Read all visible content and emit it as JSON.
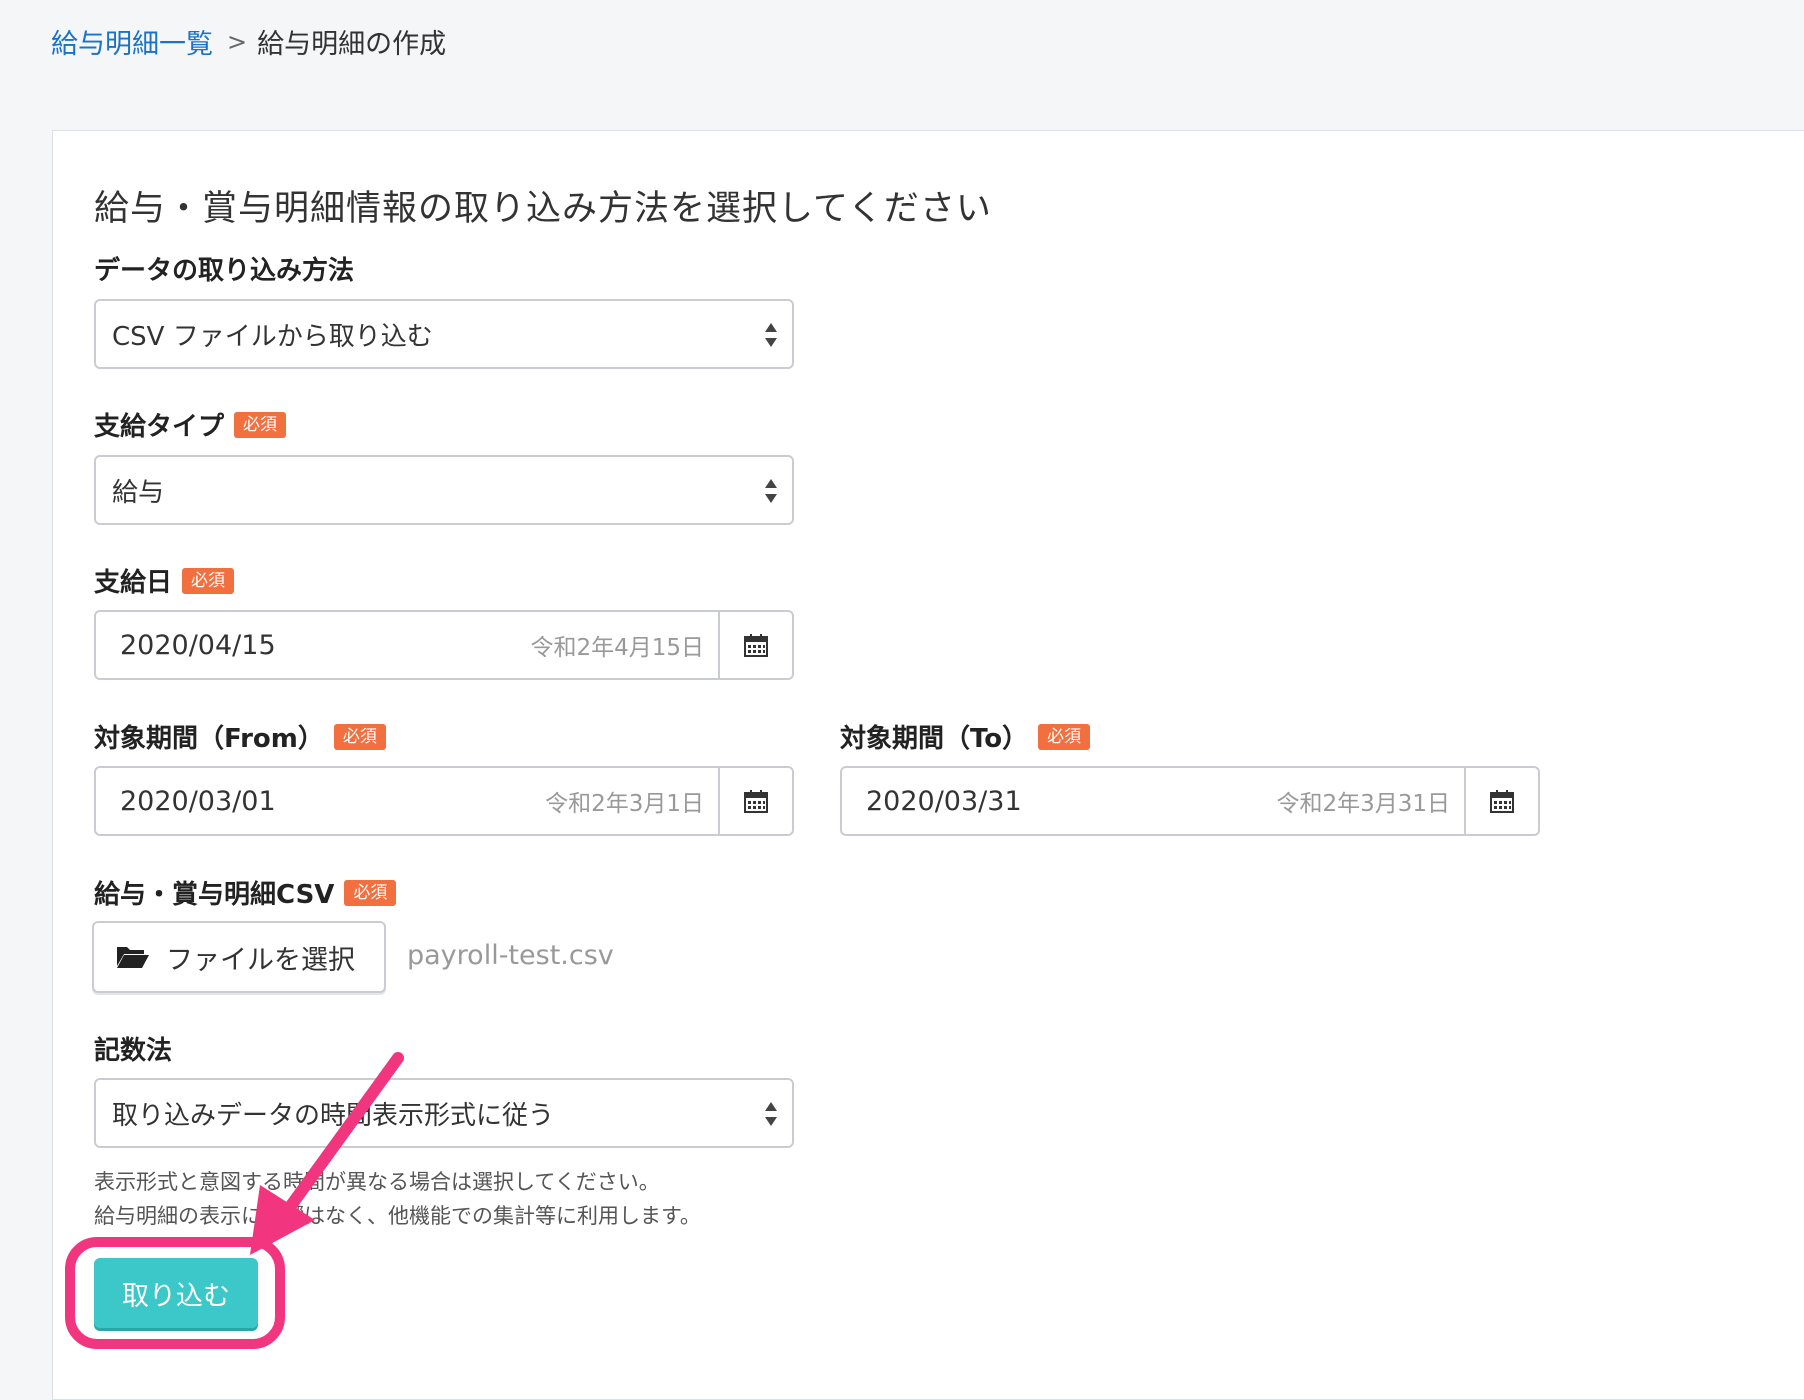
{
  "breadcrumb": {
    "link": "給与明細一覧",
    "separator": ">",
    "current": "給与明細の作成"
  },
  "form": {
    "heading": "給与・賞与明細情報の取り込み方法を選択してください",
    "required_badge": "必須",
    "import_method": {
      "label": "データの取り込み方法",
      "value": "CSV ファイルから取り込む"
    },
    "payment_type": {
      "label": "支給タイプ",
      "value": "給与"
    },
    "payment_date": {
      "label": "支給日",
      "value": "2020/04/15",
      "era": "令和2年4月15日"
    },
    "period_from": {
      "label": "対象期間（From）",
      "value": "2020/03/01",
      "era": "令和2年3月1日"
    },
    "period_to": {
      "label": "対象期間（To）",
      "value": "2020/03/31",
      "era": "令和2年3月31日"
    },
    "csv_file": {
      "label": "給与・賞与明細CSV",
      "button_label": "ファイルを選択",
      "filename": "payroll-test.csv"
    },
    "notation": {
      "label": "記数法",
      "value": "取り込みデータの時間表示形式に従う",
      "help_line1": "表示形式と意図する時間が異なる場合は選択してください。",
      "help_line2": "給与明細の表示に影響はなく、他機能での集計等に利用します。"
    },
    "submit_label": "取り込む"
  },
  "colors": {
    "link": "#1a73c8",
    "required_badge": "#f26f3f",
    "submit": "#3cc8c8",
    "annotation": "#f2357f"
  },
  "icons": [
    "chevron-right-icon",
    "sort-arrows-icon",
    "calendar-icon",
    "folder-open-icon",
    "arrow-annotation-icon"
  ]
}
